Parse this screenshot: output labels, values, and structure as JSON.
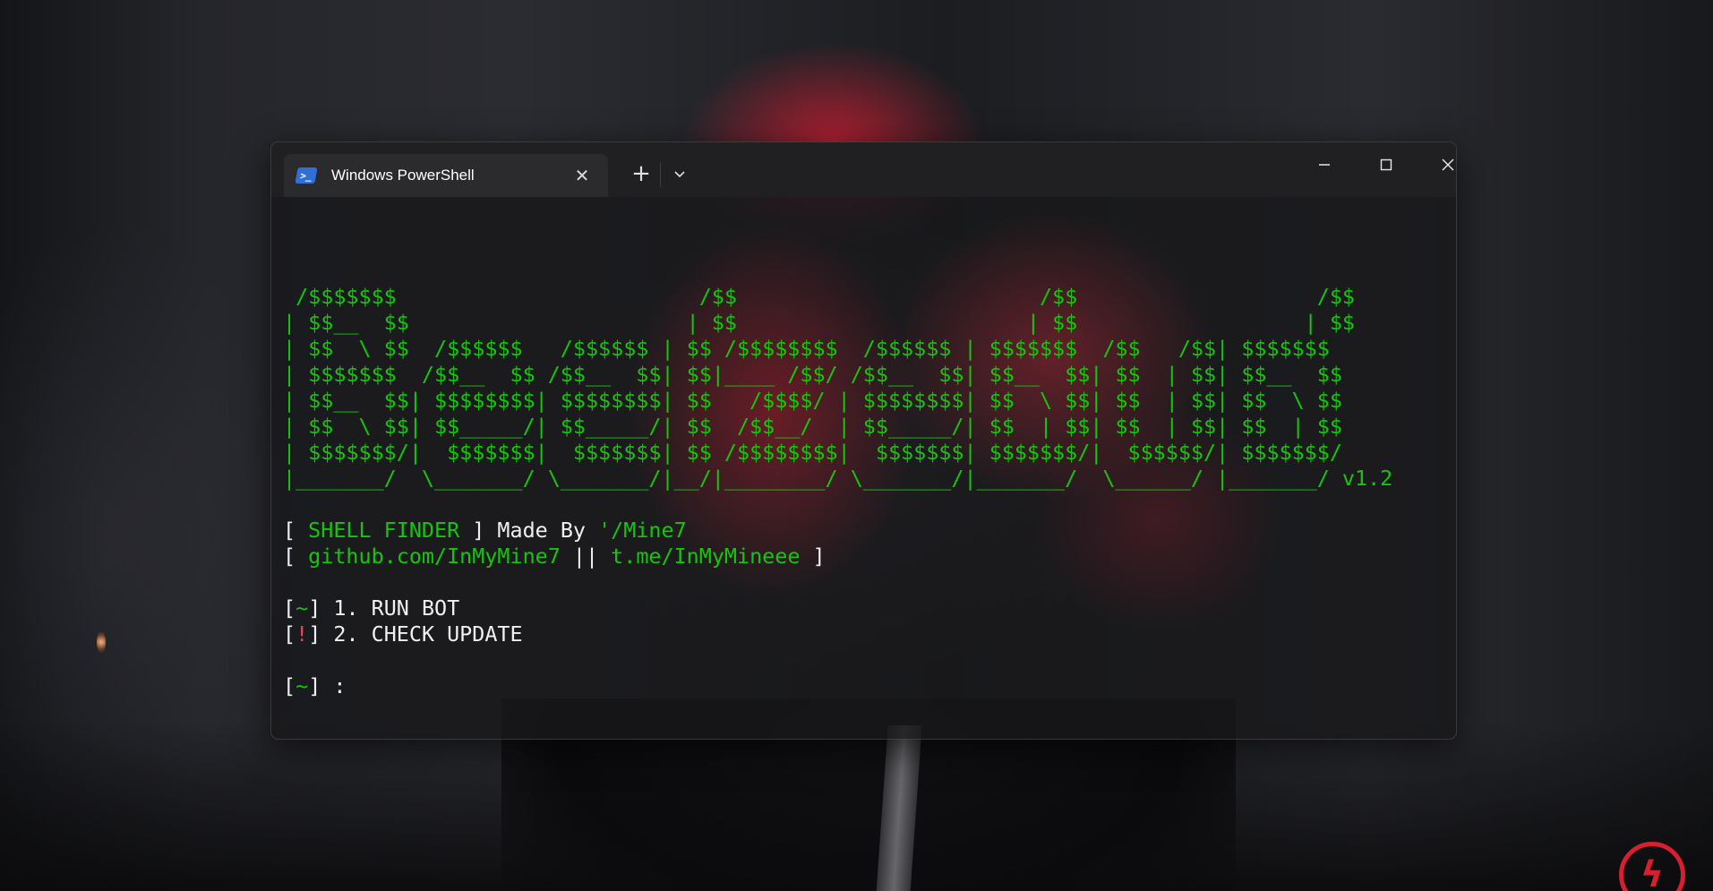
{
  "window": {
    "tab_title": "Windows PowerShell",
    "icons": {
      "app": "powershell-icon",
      "tab_close": "close-icon",
      "new_tab": "plus-icon",
      "dropdown": "chevron-down-icon",
      "minimize": "minimize-icon",
      "maximize": "maximize-icon",
      "close": "close-icon"
    }
  },
  "terminal": {
    "banner_lines": [
      " /$$$$$$$                        /$$                        /$$                   /$$",
      "| $$__  $$                      | $$                       | $$                  | $$",
      "| $$  \\ $$  /$$$$$$   /$$$$$$ | $$ /$$$$$$$$  /$$$$$$ | $$$$$$$  /$$   /$$| $$$$$$$",
      "| $$$$$$$  /$$__  $$ /$$__  $$| $$|____ /$$/ /$$__  $$| $$__  $$| $$  | $$| $$__  $$",
      "| $$__  $$| $$$$$$$$| $$$$$$$$| $$   /$$$$/ | $$$$$$$$| $$  \\ $$| $$  | $$| $$  \\ $$",
      "| $$  \\ $$| $$_____/| $$_____/| $$  /$$__/  | $$_____/| $$  | $$| $$  | $$| $$  | $$",
      "| $$$$$$$/|  $$$$$$$|  $$$$$$$| $$ /$$$$$$$$|  $$$$$$$| $$$$$$$/|  $$$$$$/| $$$$$$$/",
      "|_______/  \\_______/ \\_______/|__/|________/ \\_______/|_______/  \\______/ |_______/ v1.2"
    ],
    "info_line1": {
      "open": "[ ",
      "name": "SHELL FINDER",
      "mid": " ] Made By ",
      "author": "'/Mine7"
    },
    "info_line2": {
      "open": "[ ",
      "github": "github.com/InMyMine7",
      "sep": " || ",
      "telegram": "t.me/InMyMineee",
      "close": " ]"
    },
    "menu": [
      {
        "bracket_open": "[",
        "symbol": "~",
        "bracket_close": "]",
        "text": " 1. RUN BOT"
      },
      {
        "bracket_open": "[",
        "symbol": "!",
        "bracket_close": "]",
        "text": " 2. CHECK UPDATE"
      }
    ],
    "prompt": {
      "bracket_open": "[",
      "symbol": "~",
      "bracket_close": "]",
      "text": " :"
    }
  },
  "colors": {
    "green": "#16c60c",
    "red": "#e74856",
    "text": "#f0f0f0",
    "titlebar": "#202022",
    "tab": "#2b2b2d"
  }
}
